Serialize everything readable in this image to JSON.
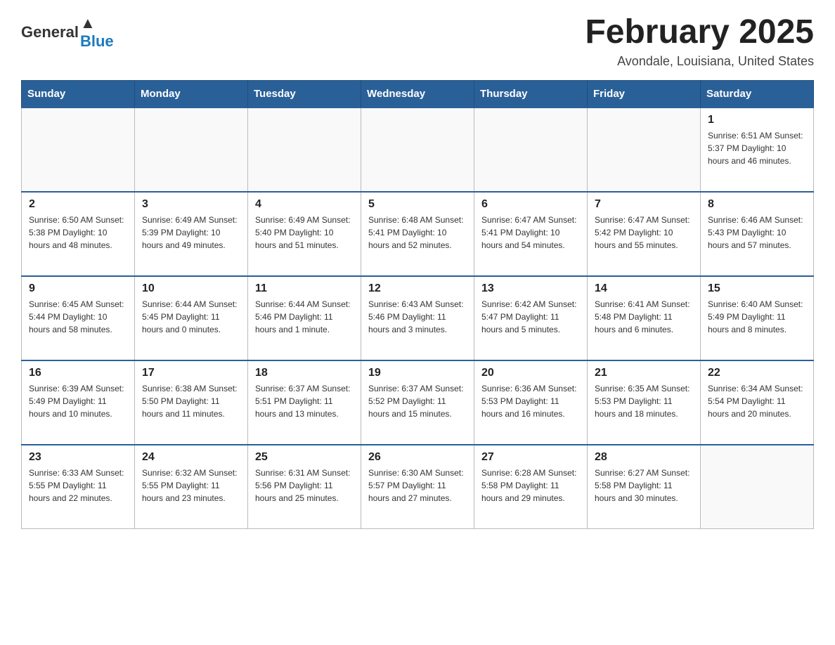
{
  "header": {
    "logo_general": "General",
    "logo_blue": "Blue",
    "title": "February 2025",
    "location": "Avondale, Louisiana, United States"
  },
  "days_of_week": [
    "Sunday",
    "Monday",
    "Tuesday",
    "Wednesday",
    "Thursday",
    "Friday",
    "Saturday"
  ],
  "weeks": [
    [
      {
        "day": "",
        "info": ""
      },
      {
        "day": "",
        "info": ""
      },
      {
        "day": "",
        "info": ""
      },
      {
        "day": "",
        "info": ""
      },
      {
        "day": "",
        "info": ""
      },
      {
        "day": "",
        "info": ""
      },
      {
        "day": "1",
        "info": "Sunrise: 6:51 AM\nSunset: 5:37 PM\nDaylight: 10 hours and 46 minutes."
      }
    ],
    [
      {
        "day": "2",
        "info": "Sunrise: 6:50 AM\nSunset: 5:38 PM\nDaylight: 10 hours and 48 minutes."
      },
      {
        "day": "3",
        "info": "Sunrise: 6:49 AM\nSunset: 5:39 PM\nDaylight: 10 hours and 49 minutes."
      },
      {
        "day": "4",
        "info": "Sunrise: 6:49 AM\nSunset: 5:40 PM\nDaylight: 10 hours and 51 minutes."
      },
      {
        "day": "5",
        "info": "Sunrise: 6:48 AM\nSunset: 5:41 PM\nDaylight: 10 hours and 52 minutes."
      },
      {
        "day": "6",
        "info": "Sunrise: 6:47 AM\nSunset: 5:41 PM\nDaylight: 10 hours and 54 minutes."
      },
      {
        "day": "7",
        "info": "Sunrise: 6:47 AM\nSunset: 5:42 PM\nDaylight: 10 hours and 55 minutes."
      },
      {
        "day": "8",
        "info": "Sunrise: 6:46 AM\nSunset: 5:43 PM\nDaylight: 10 hours and 57 minutes."
      }
    ],
    [
      {
        "day": "9",
        "info": "Sunrise: 6:45 AM\nSunset: 5:44 PM\nDaylight: 10 hours and 58 minutes."
      },
      {
        "day": "10",
        "info": "Sunrise: 6:44 AM\nSunset: 5:45 PM\nDaylight: 11 hours and 0 minutes."
      },
      {
        "day": "11",
        "info": "Sunrise: 6:44 AM\nSunset: 5:46 PM\nDaylight: 11 hours and 1 minute."
      },
      {
        "day": "12",
        "info": "Sunrise: 6:43 AM\nSunset: 5:46 PM\nDaylight: 11 hours and 3 minutes."
      },
      {
        "day": "13",
        "info": "Sunrise: 6:42 AM\nSunset: 5:47 PM\nDaylight: 11 hours and 5 minutes."
      },
      {
        "day": "14",
        "info": "Sunrise: 6:41 AM\nSunset: 5:48 PM\nDaylight: 11 hours and 6 minutes."
      },
      {
        "day": "15",
        "info": "Sunrise: 6:40 AM\nSunset: 5:49 PM\nDaylight: 11 hours and 8 minutes."
      }
    ],
    [
      {
        "day": "16",
        "info": "Sunrise: 6:39 AM\nSunset: 5:49 PM\nDaylight: 11 hours and 10 minutes."
      },
      {
        "day": "17",
        "info": "Sunrise: 6:38 AM\nSunset: 5:50 PM\nDaylight: 11 hours and 11 minutes."
      },
      {
        "day": "18",
        "info": "Sunrise: 6:37 AM\nSunset: 5:51 PM\nDaylight: 11 hours and 13 minutes."
      },
      {
        "day": "19",
        "info": "Sunrise: 6:37 AM\nSunset: 5:52 PM\nDaylight: 11 hours and 15 minutes."
      },
      {
        "day": "20",
        "info": "Sunrise: 6:36 AM\nSunset: 5:53 PM\nDaylight: 11 hours and 16 minutes."
      },
      {
        "day": "21",
        "info": "Sunrise: 6:35 AM\nSunset: 5:53 PM\nDaylight: 11 hours and 18 minutes."
      },
      {
        "day": "22",
        "info": "Sunrise: 6:34 AM\nSunset: 5:54 PM\nDaylight: 11 hours and 20 minutes."
      }
    ],
    [
      {
        "day": "23",
        "info": "Sunrise: 6:33 AM\nSunset: 5:55 PM\nDaylight: 11 hours and 22 minutes."
      },
      {
        "day": "24",
        "info": "Sunrise: 6:32 AM\nSunset: 5:55 PM\nDaylight: 11 hours and 23 minutes."
      },
      {
        "day": "25",
        "info": "Sunrise: 6:31 AM\nSunset: 5:56 PM\nDaylight: 11 hours and 25 minutes."
      },
      {
        "day": "26",
        "info": "Sunrise: 6:30 AM\nSunset: 5:57 PM\nDaylight: 11 hours and 27 minutes."
      },
      {
        "day": "27",
        "info": "Sunrise: 6:28 AM\nSunset: 5:58 PM\nDaylight: 11 hours and 29 minutes."
      },
      {
        "day": "28",
        "info": "Sunrise: 6:27 AM\nSunset: 5:58 PM\nDaylight: 11 hours and 30 minutes."
      },
      {
        "day": "",
        "info": ""
      }
    ]
  ]
}
